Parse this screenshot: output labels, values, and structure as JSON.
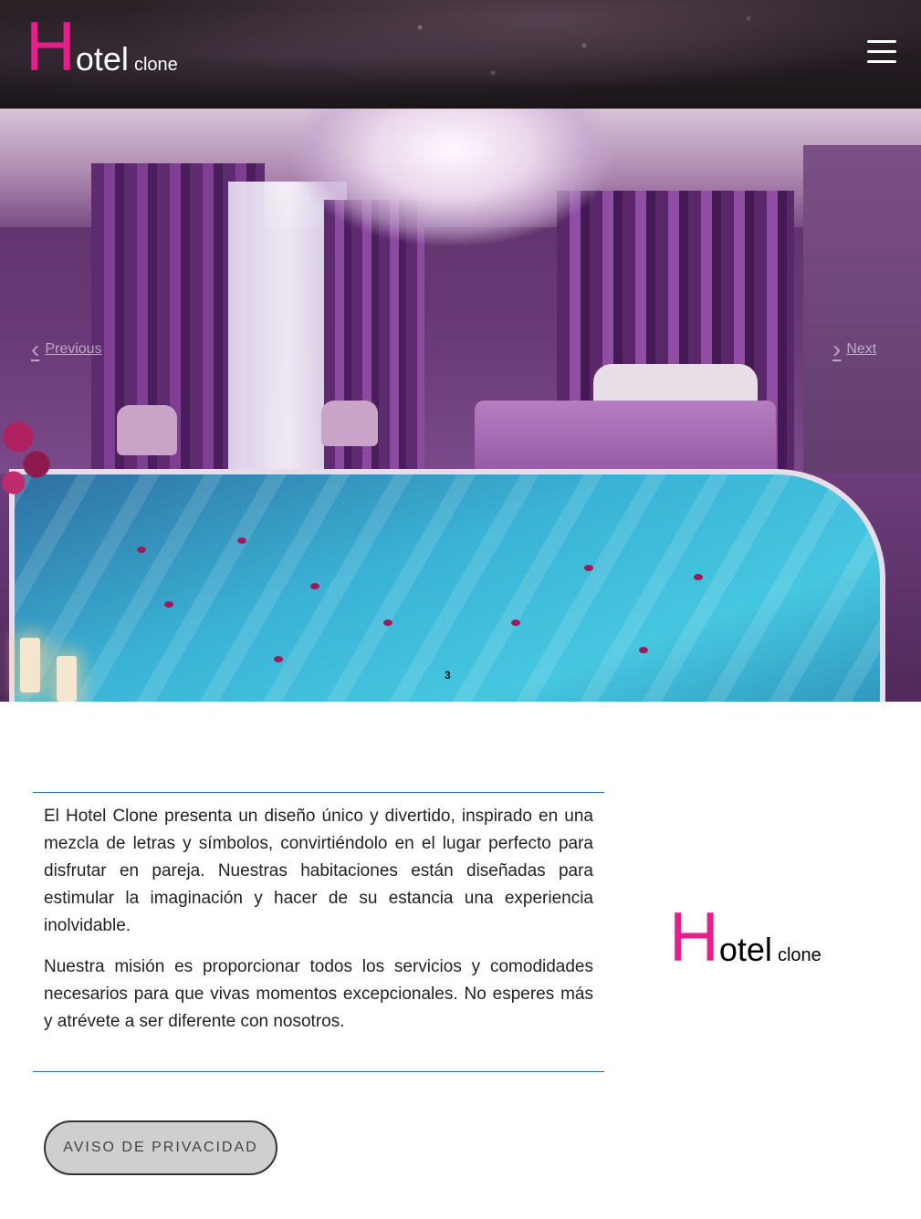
{
  "header": {
    "logo": {
      "initial": "H",
      "rest": "otel",
      "suffix": "clone"
    },
    "menu_icon": "hamburger-menu-icon"
  },
  "carousel": {
    "previous_label": "Previous",
    "next_label": "Next",
    "prev_icon": "chevron-left-icon",
    "next_icon": "chevron-right-icon",
    "indicator": "3"
  },
  "about": {
    "paragraphs": [
      "El Hotel Clone presenta un diseño único y divertido, inspirado en una mezcla de letras y símbolos, convirtiéndolo en el lugar perfecto para disfrutar en pareja. Nuestras habitaciones están diseñadas para estimular la imaginación y hacer de su estancia una experiencia inolvidable.",
      "Nuestra misión es proporcionar todos los servicios y comodidades necesarios para que vivas momentos excepcionales. No esperes más y atrévete a ser diferente con nosotros."
    ]
  },
  "footer_logo": {
    "initial": "H",
    "rest": "otel",
    "suffix": "clone"
  },
  "privacy_button": "AVISO DE PRIVACIDAD",
  "colors": {
    "brand_pink": "#e91e8c",
    "divider_blue": "#2a6fb0",
    "button_bg": "#cfcfcf"
  }
}
